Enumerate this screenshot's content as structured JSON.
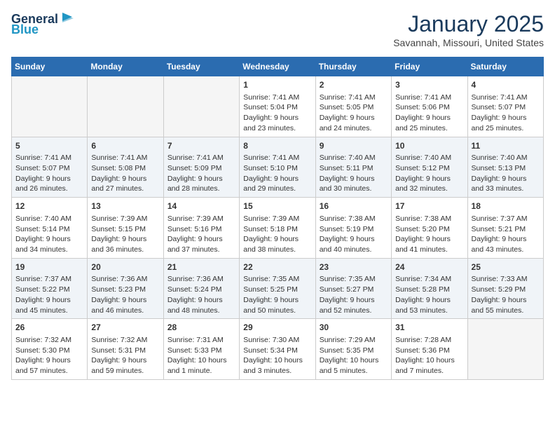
{
  "header": {
    "logo_line1": "General",
    "logo_line2": "Blue",
    "month": "January 2025",
    "location": "Savannah, Missouri, United States"
  },
  "weekdays": [
    "Sunday",
    "Monday",
    "Tuesday",
    "Wednesday",
    "Thursday",
    "Friday",
    "Saturday"
  ],
  "weeks": [
    [
      {
        "day": "",
        "info": ""
      },
      {
        "day": "",
        "info": ""
      },
      {
        "day": "",
        "info": ""
      },
      {
        "day": "1",
        "info": "Sunrise: 7:41 AM\nSunset: 5:04 PM\nDaylight: 9 hours\nand 23 minutes."
      },
      {
        "day": "2",
        "info": "Sunrise: 7:41 AM\nSunset: 5:05 PM\nDaylight: 9 hours\nand 24 minutes."
      },
      {
        "day": "3",
        "info": "Sunrise: 7:41 AM\nSunset: 5:06 PM\nDaylight: 9 hours\nand 25 minutes."
      },
      {
        "day": "4",
        "info": "Sunrise: 7:41 AM\nSunset: 5:07 PM\nDaylight: 9 hours\nand 25 minutes."
      }
    ],
    [
      {
        "day": "5",
        "info": "Sunrise: 7:41 AM\nSunset: 5:07 PM\nDaylight: 9 hours\nand 26 minutes."
      },
      {
        "day": "6",
        "info": "Sunrise: 7:41 AM\nSunset: 5:08 PM\nDaylight: 9 hours\nand 27 minutes."
      },
      {
        "day": "7",
        "info": "Sunrise: 7:41 AM\nSunset: 5:09 PM\nDaylight: 9 hours\nand 28 minutes."
      },
      {
        "day": "8",
        "info": "Sunrise: 7:41 AM\nSunset: 5:10 PM\nDaylight: 9 hours\nand 29 minutes."
      },
      {
        "day": "9",
        "info": "Sunrise: 7:40 AM\nSunset: 5:11 PM\nDaylight: 9 hours\nand 30 minutes."
      },
      {
        "day": "10",
        "info": "Sunrise: 7:40 AM\nSunset: 5:12 PM\nDaylight: 9 hours\nand 32 minutes."
      },
      {
        "day": "11",
        "info": "Sunrise: 7:40 AM\nSunset: 5:13 PM\nDaylight: 9 hours\nand 33 minutes."
      }
    ],
    [
      {
        "day": "12",
        "info": "Sunrise: 7:40 AM\nSunset: 5:14 PM\nDaylight: 9 hours\nand 34 minutes."
      },
      {
        "day": "13",
        "info": "Sunrise: 7:39 AM\nSunset: 5:15 PM\nDaylight: 9 hours\nand 36 minutes."
      },
      {
        "day": "14",
        "info": "Sunrise: 7:39 AM\nSunset: 5:16 PM\nDaylight: 9 hours\nand 37 minutes."
      },
      {
        "day": "15",
        "info": "Sunrise: 7:39 AM\nSunset: 5:18 PM\nDaylight: 9 hours\nand 38 minutes."
      },
      {
        "day": "16",
        "info": "Sunrise: 7:38 AM\nSunset: 5:19 PM\nDaylight: 9 hours\nand 40 minutes."
      },
      {
        "day": "17",
        "info": "Sunrise: 7:38 AM\nSunset: 5:20 PM\nDaylight: 9 hours\nand 41 minutes."
      },
      {
        "day": "18",
        "info": "Sunrise: 7:37 AM\nSunset: 5:21 PM\nDaylight: 9 hours\nand 43 minutes."
      }
    ],
    [
      {
        "day": "19",
        "info": "Sunrise: 7:37 AM\nSunset: 5:22 PM\nDaylight: 9 hours\nand 45 minutes."
      },
      {
        "day": "20",
        "info": "Sunrise: 7:36 AM\nSunset: 5:23 PM\nDaylight: 9 hours\nand 46 minutes."
      },
      {
        "day": "21",
        "info": "Sunrise: 7:36 AM\nSunset: 5:24 PM\nDaylight: 9 hours\nand 48 minutes."
      },
      {
        "day": "22",
        "info": "Sunrise: 7:35 AM\nSunset: 5:25 PM\nDaylight: 9 hours\nand 50 minutes."
      },
      {
        "day": "23",
        "info": "Sunrise: 7:35 AM\nSunset: 5:27 PM\nDaylight: 9 hours\nand 52 minutes."
      },
      {
        "day": "24",
        "info": "Sunrise: 7:34 AM\nSunset: 5:28 PM\nDaylight: 9 hours\nand 53 minutes."
      },
      {
        "day": "25",
        "info": "Sunrise: 7:33 AM\nSunset: 5:29 PM\nDaylight: 9 hours\nand 55 minutes."
      }
    ],
    [
      {
        "day": "26",
        "info": "Sunrise: 7:32 AM\nSunset: 5:30 PM\nDaylight: 9 hours\nand 57 minutes."
      },
      {
        "day": "27",
        "info": "Sunrise: 7:32 AM\nSunset: 5:31 PM\nDaylight: 9 hours\nand 59 minutes."
      },
      {
        "day": "28",
        "info": "Sunrise: 7:31 AM\nSunset: 5:33 PM\nDaylight: 10 hours\nand 1 minute."
      },
      {
        "day": "29",
        "info": "Sunrise: 7:30 AM\nSunset: 5:34 PM\nDaylight: 10 hours\nand 3 minutes."
      },
      {
        "day": "30",
        "info": "Sunrise: 7:29 AM\nSunset: 5:35 PM\nDaylight: 10 hours\nand 5 minutes."
      },
      {
        "day": "31",
        "info": "Sunrise: 7:28 AM\nSunset: 5:36 PM\nDaylight: 10 hours\nand 7 minutes."
      },
      {
        "day": "",
        "info": ""
      }
    ]
  ]
}
